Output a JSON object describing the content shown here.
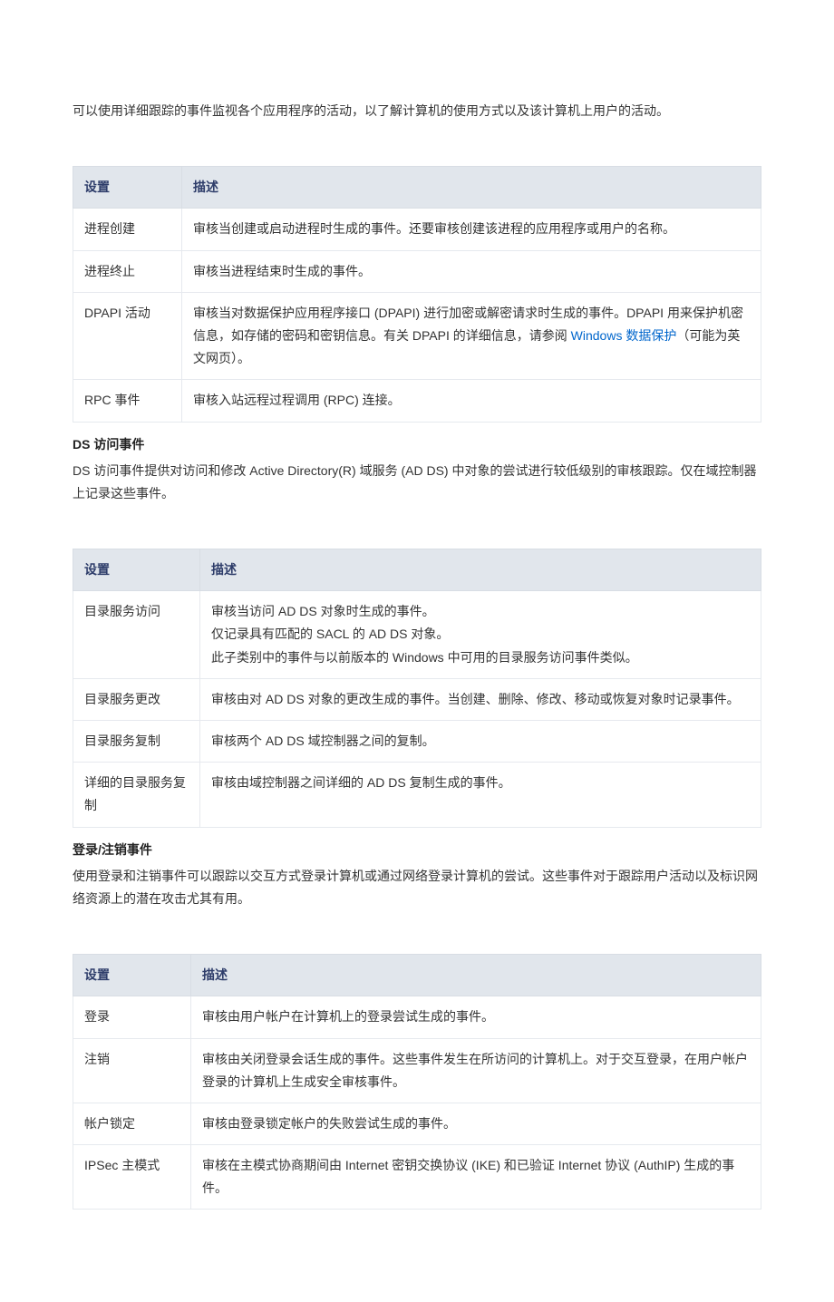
{
  "intro": "可以使用详细跟踪的事件监视各个应用程序的活动，以了解计算机的使用方式以及该计算机上用户的活动。",
  "headers": {
    "setting": "设置",
    "desc": "描述"
  },
  "table1": {
    "rows": [
      {
        "setting": "进程创建",
        "desc": "审核当创建或启动进程时生成的事件。还要审核创建该进程的应用程序或用户的名称。"
      },
      {
        "setting": "进程终止",
        "desc": "审核当进程结束时生成的事件。"
      },
      {
        "setting": "DPAPI 活动",
        "desc_pre": "审核当对数据保护应用程序接口 (DPAPI) 进行加密或解密请求时生成的事件。DPAPI 用来保护机密信息，如存储的密码和密钥信息。有关 DPAPI 的详细信息，请参阅 ",
        "link": "Windows 数据保护",
        "desc_post": "（可能为英文网页）。"
      },
      {
        "setting": "RPC 事件",
        "desc": "审核入站远程过程调用 (RPC) 连接。"
      }
    ]
  },
  "section_ds": {
    "title": "DS 访问事件",
    "desc": "DS 访问事件提供对访问和修改 Active Directory(R) 域服务 (AD DS) 中对象的尝试进行较低级别的审核跟踪。仅在域控制器上记录这些事件。"
  },
  "table2": {
    "rows": [
      {
        "setting": "目录服务访问",
        "lines": [
          "审核当访问 AD DS 对象时生成的事件。",
          "仅记录具有匹配的 SACL 的 AD DS 对象。",
          "此子类别中的事件与以前版本的 Windows 中可用的目录服务访问事件类似。"
        ]
      },
      {
        "setting": "目录服务更改",
        "desc": "审核由对 AD DS 对象的更改生成的事件。当创建、删除、修改、移动或恢复对象时记录事件。"
      },
      {
        "setting": "目录服务复制",
        "desc": "审核两个 AD DS 域控制器之间的复制。"
      },
      {
        "setting": "详细的目录服务复制",
        "desc": "审核由域控制器之间详细的 AD DS 复制生成的事件。"
      }
    ]
  },
  "section_logon": {
    "title": "登录/注销事件",
    "desc": "使用登录和注销事件可以跟踪以交互方式登录计算机或通过网络登录计算机的尝试。这些事件对于跟踪用户活动以及标识网络资源上的潜在攻击尤其有用。"
  },
  "table3": {
    "rows": [
      {
        "setting": "登录",
        "desc": "审核由用户帐户在计算机上的登录尝试生成的事件。"
      },
      {
        "setting": "注销",
        "desc": "审核由关闭登录会话生成的事件。这些事件发生在所访问的计算机上。对于交互登录，在用户帐户登录的计算机上生成安全审核事件。"
      },
      {
        "setting": "帐户锁定",
        "desc": "审核由登录锁定帐户的失败尝试生成的事件。"
      },
      {
        "setting": "IPSec 主模式",
        "desc": "审核在主模式协商期间由 Internet 密钥交换协议 (IKE) 和已验证 Internet 协议 (AuthIP) 生成的事件。"
      }
    ]
  }
}
